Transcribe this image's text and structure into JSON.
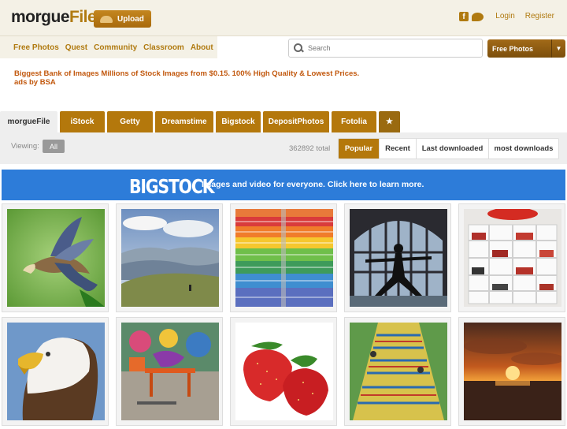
{
  "header": {
    "logo_main": "morgue",
    "logo_accent": "File",
    "upload_label": "Upload",
    "login": "Login",
    "register": "Register"
  },
  "nav": [
    "Free Photos",
    "Quest",
    "Community",
    "Classroom",
    "About"
  ],
  "search": {
    "placeholder": "Search"
  },
  "dropdown": {
    "label": "Free Photos"
  },
  "ad": {
    "line1": "Biggest Bank of Images Millions of Stock Images from $0.15. 100% High Quality & Lowest Prices.",
    "line2": "ads by BSA"
  },
  "tabs": [
    "morgueFile",
    "iStock",
    "Getty",
    "Dreamstime",
    "Bigstock",
    "DepositPhotos",
    "Fotolia",
    "★"
  ],
  "filter": {
    "viewing_label": "Viewing:",
    "all_label": "All",
    "total": "362892 total",
    "sort": [
      "Popular",
      "Recent",
      "Last downloaded",
      "most downloads"
    ]
  },
  "banner": {
    "brand": "BIGSTOCK",
    "text": "Images and video for everyone. Click here to learn more."
  },
  "photos": [
    "bird-photo",
    "mountain-photo",
    "rainbow-stairs-photo",
    "yoga-window-photo",
    "bookshelf-photo",
    "eagle-photo",
    "graffiti-cafe-photo",
    "strawberries-photo",
    "tiled-stairs-photo",
    "sunset-photo"
  ],
  "colors": {
    "accent": "#b4780c",
    "banner": "#2d7cd9",
    "link": "#b07a10"
  }
}
